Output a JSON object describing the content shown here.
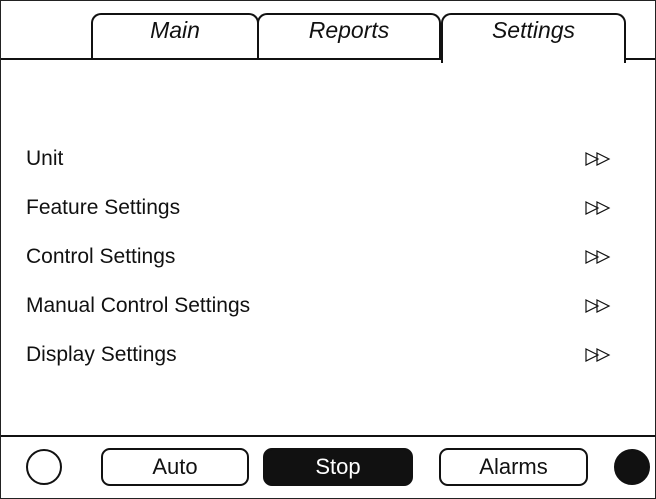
{
  "tabs": [
    {
      "label": "Main",
      "active": false
    },
    {
      "label": "Reports",
      "active": false
    },
    {
      "label": "Settings",
      "active": true
    }
  ],
  "menu": {
    "items": [
      {
        "label": "Unit",
        "icon": "double-arrow-right-icon"
      },
      {
        "label": "Feature Settings",
        "icon": "double-arrow-right-icon"
      },
      {
        "label": "Control Settings",
        "icon": "double-arrow-right-icon"
      },
      {
        "label": "Manual Control Settings",
        "icon": "double-arrow-right-icon"
      },
      {
        "label": "Display Settings",
        "icon": "double-arrow-right-icon"
      }
    ]
  },
  "bottom_bar": {
    "auto_label": "Auto",
    "stop_label": "Stop",
    "alarms_label": "Alarms",
    "left_indicator": "empty-circle",
    "right_indicator": "filled-circle"
  },
  "colors": {
    "foreground": "#111111",
    "background": "#ffffff",
    "active_button": "#111111"
  }
}
